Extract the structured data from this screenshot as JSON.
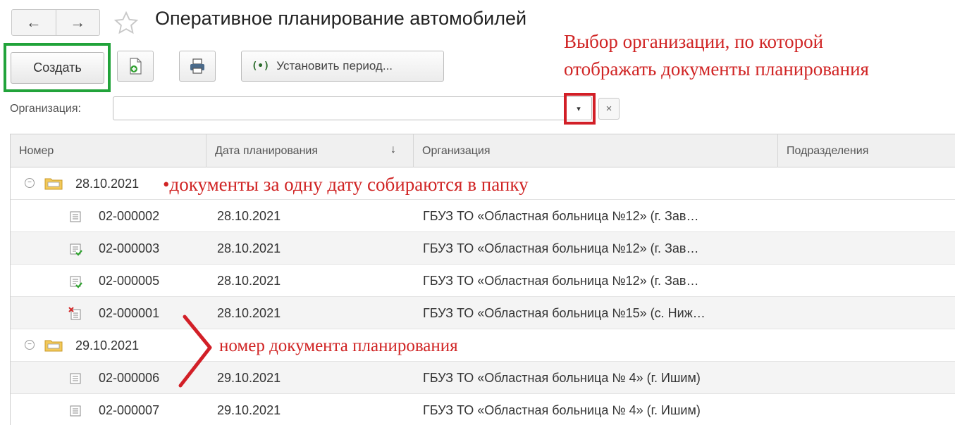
{
  "window": {
    "title": "Оперативное планирование автомобилей",
    "back_label": "←",
    "forward_label": "→"
  },
  "toolbar": {
    "create_label": "Создать",
    "period_icon": "(•)",
    "period_label": "Установить период..."
  },
  "filter": {
    "org_label": "Организация:",
    "org_value": "",
    "dropdown_glyph": "▾",
    "clear_glyph": "×"
  },
  "annotations": {
    "org_hint_line1": "Выбор организации, по которой",
    "org_hint_line2": "отображать документы планирования",
    "folder_hint_dot": "•",
    "folder_hint": "документы за одну дату собираются в папку",
    "number_hint": "номер документа планирования"
  },
  "table": {
    "columns": {
      "number": "Номер",
      "date": "Дата планирования",
      "sort": "↓",
      "org": "Организация",
      "department": "Подразделения"
    },
    "groups": [
      {
        "label": "28.10.2021",
        "toggle": "−",
        "rows": [
          {
            "icon": "document-icon",
            "number": "02-000002",
            "date": "28.10.2021",
            "org": "ГБУЗ ТО «Областная больница №12» (г. Зав…"
          },
          {
            "icon": "document-posted-icon",
            "number": "02-000003",
            "date": "28.10.2021",
            "org": "ГБУЗ ТО «Областная больница №12» (г. Зав…"
          },
          {
            "icon": "document-posted-icon",
            "number": "02-000005",
            "date": "28.10.2021",
            "org": "ГБУЗ ТО «Областная больница №12» (г. Зав…"
          },
          {
            "icon": "document-deleted-icon",
            "number": "02-000001",
            "date": "28.10.2021",
            "org": "ГБУЗ ТО «Областная больница №15» (с. Ниж…"
          }
        ]
      },
      {
        "label": "29.10.2021",
        "toggle": "−",
        "rows": [
          {
            "icon": "document-icon",
            "number": "02-000006",
            "date": "29.10.2021",
            "org": "ГБУЗ ТО «Областная больница № 4» (г. Ишим)"
          },
          {
            "icon": "document-icon",
            "number": "02-000007",
            "date": "29.10.2021",
            "org": "ГБУЗ ТО «Областная больница № 4» (г. Ишим)"
          }
        ]
      }
    ]
  },
  "colors": {
    "green_highlight": "#21a33a",
    "red_highlight": "#d21f27",
    "annotation_text": "#d02424"
  }
}
